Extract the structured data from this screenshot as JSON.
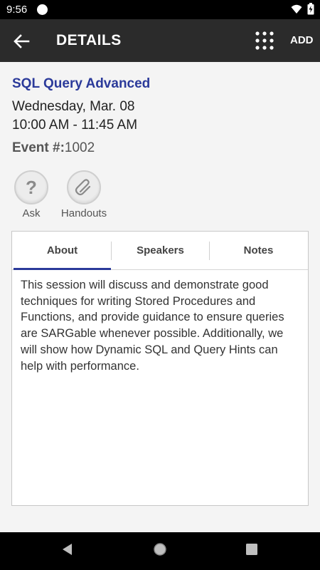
{
  "status": {
    "time": "9:56"
  },
  "app_bar": {
    "title": "DETAILS",
    "add_label": "ADD"
  },
  "session": {
    "title": "SQL Query Advanced",
    "date": "Wednesday, Mar. 08",
    "time": "10:00 AM - 11:45 AM",
    "event_label": "Event #:",
    "event_number": "1002"
  },
  "actions": [
    {
      "label": "Ask",
      "icon": "question-icon"
    },
    {
      "label": "Handouts",
      "icon": "paperclip-icon"
    }
  ],
  "tabs": [
    {
      "label": "About",
      "selected": true
    },
    {
      "label": "Speakers",
      "selected": false
    },
    {
      "label": "Notes",
      "selected": false
    }
  ],
  "about": {
    "text": "This session will discuss and demonstrate good techniques for writing Stored Procedures and Functions, and provide guidance to ensure queries are SARGable whenever possible. Additionally, we will show how Dynamic SQL and Query Hints can help with performance."
  },
  "colors": {
    "accent": "#2b3a9a",
    "app_bar": "#2b2b2b"
  }
}
